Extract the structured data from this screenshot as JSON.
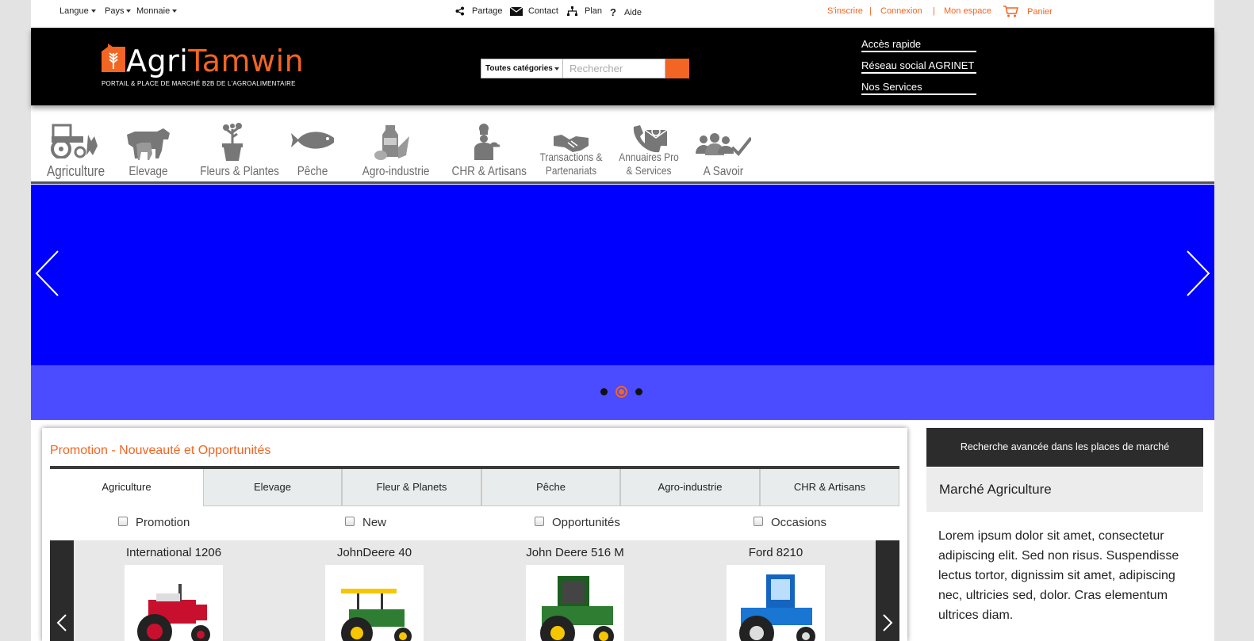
{
  "topbar": {
    "language": "Langue",
    "country": "Pays",
    "currency": "Monnaie",
    "share": "Partage",
    "contact": "Contact",
    "plan": "Plan",
    "help": "Aide",
    "signup": "S'inscrire",
    "login": "Connexion",
    "my_space": "Mon espace",
    "cart": "Panier",
    "separator": "|",
    "accent_color": "#f26522"
  },
  "header": {
    "logo_agri": "Agri",
    "logo_tamwin": "Tamwin",
    "tagline": "PORTAIL & PLACE DE MARCHÉ B2B DE L'AGROALIMENTAIRE",
    "search_category": "Toutes catégories",
    "search_placeholder": "Rechercher",
    "quick_links": [
      "Accès rapide",
      "Réseau social AGRINET",
      "Nos Services"
    ]
  },
  "categories": [
    {
      "label": "Agriculture",
      "icon": "tractor-icon"
    },
    {
      "label": "Elevage",
      "icon": "cattle-icon"
    },
    {
      "label": "Fleurs & Plantes",
      "icon": "potted-plant-icon"
    },
    {
      "label": "Pêche",
      "icon": "fish-icon"
    },
    {
      "label": "Agro-industrie",
      "icon": "milk-carton-icon"
    },
    {
      "label": "CHR & Artisans",
      "icon": "chef-icon"
    },
    {
      "label_line1": "Transactions &",
      "label_line2": "Partenariats",
      "icon": "handshake-icon"
    },
    {
      "label_line1": "Annuaires Pro",
      "label_line2": "& Services",
      "icon": "contact-directory-icon"
    },
    {
      "label": "A Savoir",
      "icon": "people-check-icon"
    }
  ],
  "slider": {
    "slide_color": "#0000fe",
    "caption_color": "#4b4bff",
    "slide_count": 3,
    "active_index": 1
  },
  "promo": {
    "title": "Promotion - Nouveauté et Opportunités",
    "tabs": [
      "Agriculture",
      "Elevage",
      "Fleur & Planets",
      "Pêche",
      "Agro-industrie",
      "CHR & Artisans"
    ],
    "active_tab": 0,
    "filters": [
      "Promotion",
      "New",
      "Opportunités",
      "Occasions"
    ],
    "products": [
      {
        "name": "International 1206",
        "image": "red-tractor"
      },
      {
        "name": "JohnDeere 40",
        "image": "green-tractor"
      },
      {
        "name": "John Deere 516 M",
        "image": "green-cab-tractor"
      },
      {
        "name": "Ford 8210",
        "image": "blue-tractor"
      }
    ]
  },
  "side": {
    "heading": "Recherche avancée dans les places de marché",
    "market": "Marché Agriculture",
    "body": "Lorem ipsum dolor sit amet, consectetur adipiscing elit. Sed non risus. Suspendisse lectus tortor, dignissim sit amet, adipiscing nec, ultricies sed, dolor. Cras elementum ultrices diam."
  }
}
